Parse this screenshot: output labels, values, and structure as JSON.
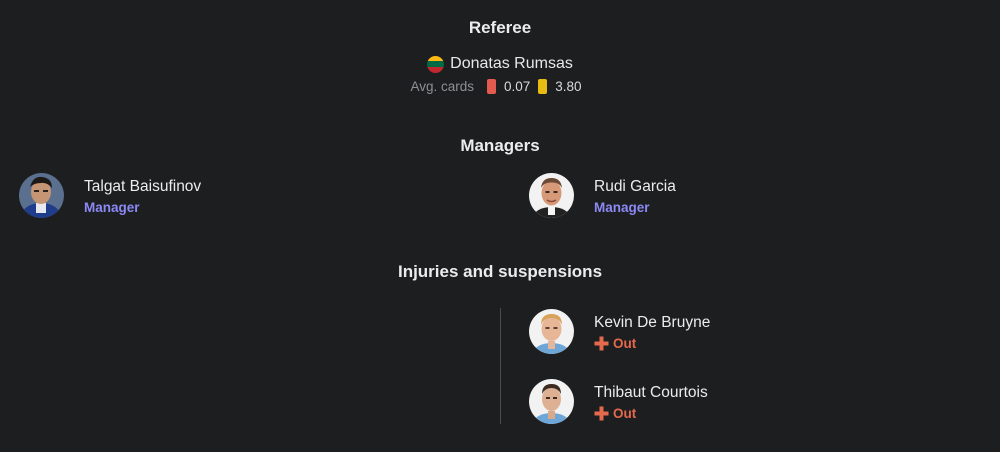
{
  "referee": {
    "title": "Referee",
    "name": "Donatas Rumsas",
    "country_flag": "lithuania-flag-icon",
    "avg_cards_label": "Avg. cards",
    "red_avg": "0.07",
    "yellow_avg": "3.80",
    "colors": {
      "red_card": "#e35a4e",
      "yellow_card": "#e6bb12"
    }
  },
  "managers": {
    "title": "Managers",
    "home": {
      "name": "Talgat Baisufinov",
      "role": "Manager"
    },
    "away": {
      "name": "Rudi Garcia",
      "role": "Manager"
    }
  },
  "injuries": {
    "title": "Injuries and suspensions",
    "away": [
      {
        "name": "Kevin De Bruyne",
        "status": "Out",
        "icon": "medical-cross-icon"
      },
      {
        "name": "Thibaut Courtois",
        "status": "Out",
        "icon": "medical-cross-icon"
      }
    ]
  },
  "colors": {
    "background": "#1d1e20",
    "role_accent": "#8c89f4",
    "out_status": "#e5694c"
  }
}
